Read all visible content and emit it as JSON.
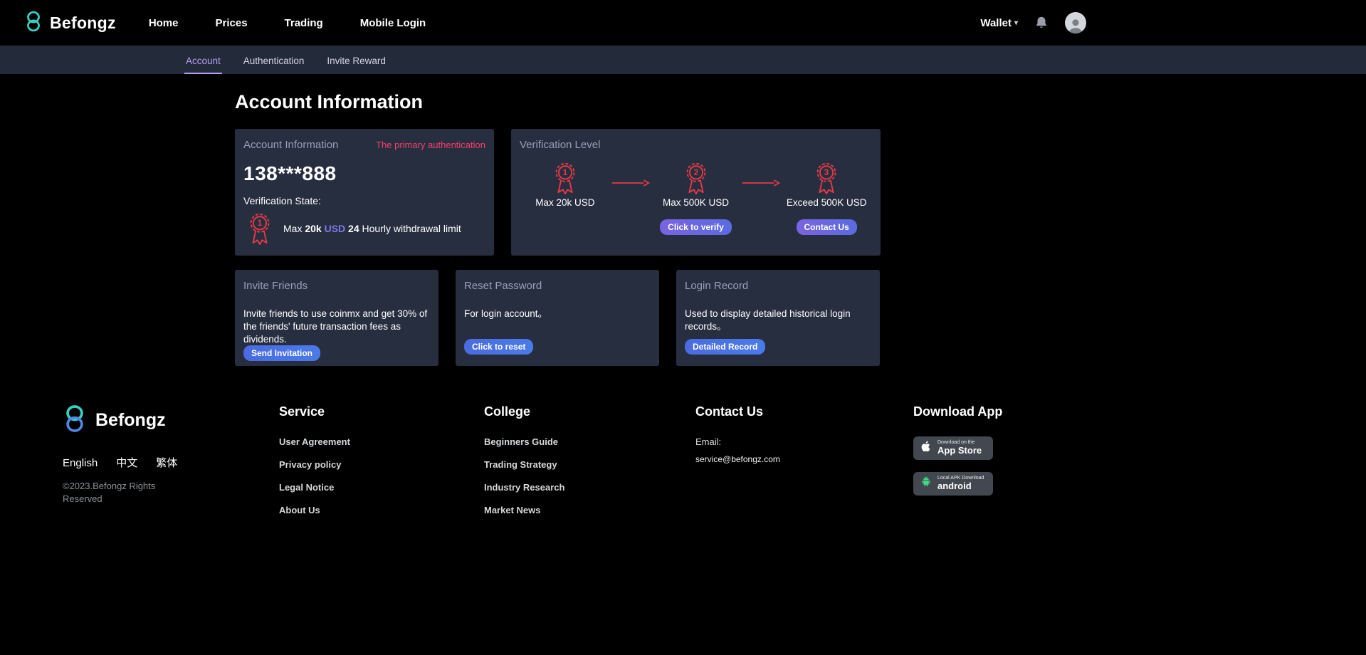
{
  "colors": {
    "accent_purple": "#b79df0",
    "button_purple": "#6a63d8",
    "button_blue": "#4a6be0",
    "medal_red": "#e63946",
    "pink": "#f43f6b",
    "brand_teal": "#35d0c2",
    "card_bg": "#272e40",
    "subnav_bg": "#232b3b"
  },
  "navbar": {
    "brand": "Befongz",
    "items": [
      {
        "label": "Home"
      },
      {
        "label": "Prices"
      },
      {
        "label": "Trading"
      },
      {
        "label": "Mobile Login"
      }
    ],
    "wallet": "Wallet"
  },
  "subnav": {
    "tabs": [
      {
        "label": "Account"
      },
      {
        "label": "Authentication"
      },
      {
        "label": "Invite Reward"
      }
    ]
  },
  "main": {
    "title": "Account Information",
    "account_card": {
      "title": "Account Information",
      "badge": "The primary authentication",
      "phone": "138***888",
      "state_label": "Verification State:",
      "medal_number": "1",
      "limit": {
        "prefix": "Max ",
        "amount": "20k ",
        "currency": "USD ",
        "hours": "24 ",
        "suffix": "Hourly withdrawal limit"
      }
    },
    "verification_card": {
      "title": "Verification Level",
      "levels": [
        {
          "number": "1",
          "label": "Max 20k USD",
          "button": ""
        },
        {
          "number": "2",
          "label": "Max 500K USD",
          "button": "Click to verify"
        },
        {
          "number": "3",
          "label": "Exceed 500K USD",
          "button": "Contact Us"
        }
      ]
    },
    "cards": [
      {
        "title": "Invite Friends",
        "body": "Invite friends to use coinmx and get 30% of the friends' future transaction fees as dividends.",
        "button": "Send Invitation"
      },
      {
        "title": "Reset Password",
        "body": "For login account。",
        "button": "Click to reset"
      },
      {
        "title": "Login Record",
        "body": "Used to display detailed historical login records。",
        "button": "Detailed Record"
      }
    ]
  },
  "footer": {
    "brand": "Befongz",
    "languages": [
      "English",
      "中文",
      "繁体"
    ],
    "copyright": "©2023.Befongz Rights Reserved",
    "columns": [
      {
        "title": "Service",
        "links": [
          "User Agreement",
          "Privacy policy",
          "Legal Notice",
          "About Us"
        ]
      },
      {
        "title": "College",
        "links": [
          "Beginners Guide",
          "Trading Strategy",
          "Industry Research",
          "Market News"
        ]
      }
    ],
    "contact": {
      "title": "Contact Us",
      "email_label": "Email:",
      "email": "service@befongz.com"
    },
    "download": {
      "title": "Download App",
      "appstore": {
        "line1": "Download on the",
        "line2": "App Store"
      },
      "android": {
        "line1": "Local APK Download",
        "line2": "android"
      }
    }
  }
}
